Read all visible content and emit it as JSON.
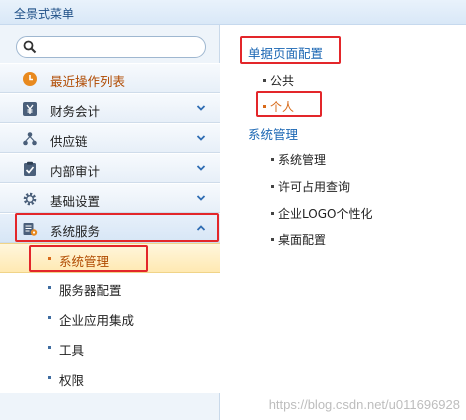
{
  "header": {
    "title": "全景式菜单"
  },
  "search": {
    "placeholder": ""
  },
  "sidebar": {
    "items": [
      {
        "label": "最近操作列表",
        "icon": "clock-icon"
      },
      {
        "label": "财务会计",
        "icon": "yen-icon"
      },
      {
        "label": "供应链",
        "icon": "supply-chain-icon"
      },
      {
        "label": "内部审计",
        "icon": "clipboard-check-icon"
      },
      {
        "label": "基础设置",
        "icon": "gear-icon"
      },
      {
        "label": "系统服务",
        "icon": "system-service-icon"
      }
    ],
    "subitems": [
      {
        "label": "系统管理",
        "selected": true
      },
      {
        "label": "服务器配置"
      },
      {
        "label": "企业应用集成"
      },
      {
        "label": "工具"
      },
      {
        "label": "权限"
      }
    ]
  },
  "content": {
    "section1": {
      "title": "单据页面配置",
      "items": [
        "公共",
        "个人"
      ]
    },
    "section2": {
      "title": "系统管理",
      "items": [
        "系统管理",
        "许可占用查询",
        "企业LOGO个性化",
        "桌面配置"
      ]
    }
  },
  "watermark": "https://blog.csdn.net/u011696928",
  "colors": {
    "accent": "#1a66b3",
    "highlight_red": "#e3262a",
    "selected_orange": "#d86a1a"
  }
}
